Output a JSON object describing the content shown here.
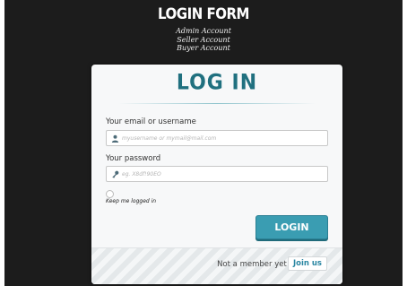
{
  "header": {
    "title": "LOGIN FORM",
    "accounts": [
      "Admin Account",
      "Seller Account",
      "Buyer Account"
    ]
  },
  "form": {
    "title": "LOG IN",
    "username": {
      "label": "Your email or username",
      "placeholder": "myusername or mymail@mail.com",
      "icon": "user-icon"
    },
    "password": {
      "label": "Your password",
      "placeholder": "eg. X8df!90EO",
      "icon": "key-icon"
    },
    "keep_logged_in": "Keep me logged in",
    "login_button": "LOGIN"
  },
  "footer": {
    "prompt": "Not a member yet ?",
    "join_button": "Join us"
  },
  "colors": {
    "accent": "#3a9db2",
    "title": "#20707f",
    "background": "#1c1c1c"
  }
}
